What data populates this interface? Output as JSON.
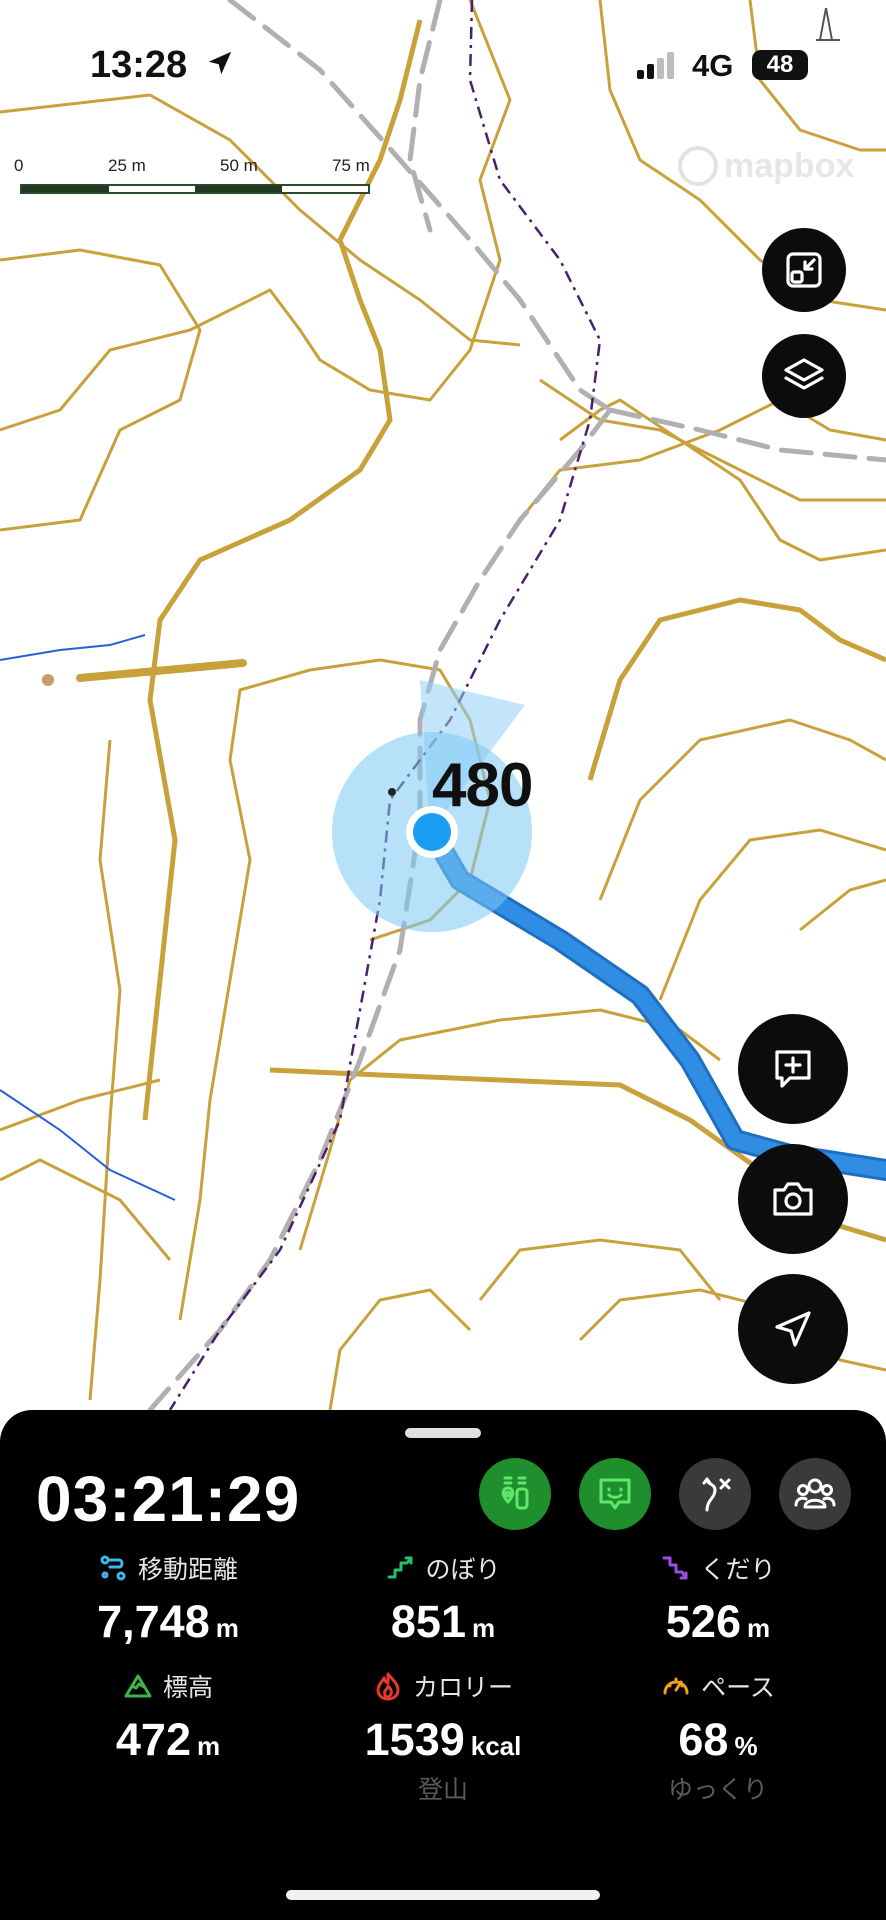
{
  "status_bar": {
    "time": "13:28",
    "network": "4G",
    "battery": "48"
  },
  "map": {
    "scale_labels": [
      "0",
      "25 m",
      "50 m",
      "75 m"
    ],
    "attribution": "mapbox",
    "elevation_label": "480",
    "colors": {
      "contour": "#c9a13a",
      "route": "#2f8de4",
      "trail": "#b0b0b0",
      "path": "#4b1e6e",
      "stream": "#2a5fd6",
      "location": "#1a9cf0"
    }
  },
  "map_controls": [
    "exit-fullscreen-icon",
    "layers-icon",
    "add-note-icon",
    "camera-icon",
    "locate-arrow-icon"
  ],
  "tracking": {
    "elapsed": "03:21:29",
    "toggles": [
      {
        "icon": "trail-marker-icon",
        "active": true
      },
      {
        "icon": "chat-face-icon",
        "active": true
      },
      {
        "icon": "route-branch-icon",
        "active": false
      },
      {
        "icon": "group-icon",
        "active": false
      }
    ],
    "stats": [
      {
        "label": "移動距離",
        "value": "7,748",
        "unit": "m",
        "icon": "distance-icon",
        "color": "#3db8e8"
      },
      {
        "label": "のぼり",
        "value": "851",
        "unit": "m",
        "icon": "ascent-icon",
        "color": "#25c26a"
      },
      {
        "label": "くだり",
        "value": "526",
        "unit": "m",
        "icon": "descent-icon",
        "color": "#9b4ee6"
      },
      {
        "label": "標高",
        "value": "472",
        "unit": "m",
        "icon": "mountain-icon",
        "color": "#3fb44b"
      },
      {
        "label": "カロリー",
        "value": "1539",
        "unit": "kcal",
        "icon": "flame-icon",
        "color": "#e8382c",
        "sub": "登山"
      },
      {
        "label": "ペース",
        "value": "68",
        "unit": "%",
        "icon": "speedometer-icon",
        "color": "#f0a020",
        "sub": "ゆっくり"
      }
    ]
  }
}
